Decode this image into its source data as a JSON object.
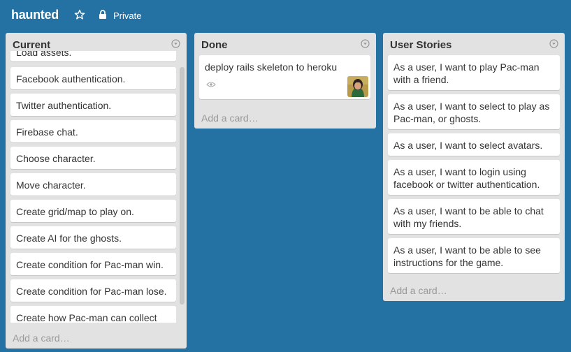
{
  "header": {
    "board_name": "haunted",
    "privacy": "Private"
  },
  "lists": {
    "current": {
      "title": "Current",
      "add_card": "Add a card…",
      "cards": [
        "Load assets.",
        "Facebook authentication.",
        "Twitter authentication.",
        "Firebase chat.",
        "Choose character.",
        "Move character.",
        "Create grid/map to play on.",
        "Create AI for the ghosts.",
        "Create condition for Pac-man win.",
        "Create condition for Pac-man lose.",
        "Create how Pac-man can collect"
      ]
    },
    "done": {
      "title": "Done",
      "add_card": "Add a card…",
      "cards": [
        "deploy rails skeleton to heroku"
      ]
    },
    "user_stories": {
      "title": "User Stories",
      "add_card": "Add a card…",
      "cards": [
        "As a user, I want to play Pac-man with a friend.",
        "As a user, I want to select to play as Pac-man, or ghosts.",
        "As a user, I want to select avatars.",
        "As a user, I want to login using facebook or twitter authentication.",
        "As a user, I want to be able to chat with my friends.",
        "As a user, I want to be able to see instructions for the game."
      ]
    }
  },
  "colors": {
    "board_background": "#2471a3",
    "list_background": "#e2e2e2",
    "card_background": "#ffffff"
  },
  "icons": {
    "star": "star-icon",
    "lock": "lock-icon",
    "list_menu": "chevron-circle-icon",
    "watch": "eye-icon",
    "member": "avatar"
  }
}
